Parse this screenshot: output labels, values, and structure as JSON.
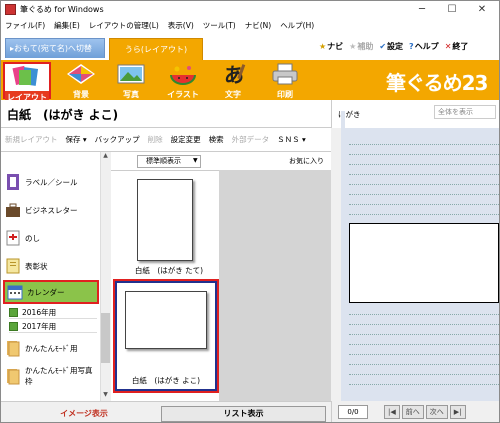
{
  "window": {
    "title": "筆ぐるめ for Windows",
    "min": "─",
    "max": "☐",
    "close": "✕"
  },
  "menu": [
    "ファイル(F)",
    "編集(E)",
    "レイアウトの管理(L)",
    "表示(V)",
    "ツール(T)",
    "ナビ(N)",
    "ヘルプ(H)"
  ],
  "tabs": {
    "front": "▸おもて(宛て名)へ切替",
    "back": "うら(レイアウト)"
  },
  "toplinks": [
    {
      "icon": "★",
      "label": "ナビ",
      "color": "#d4a000"
    },
    {
      "icon": "★",
      "label": "補助",
      "color": "#bbbbbb"
    },
    {
      "icon": "✔",
      "label": "設定",
      "color": "#2c6fc4"
    },
    {
      "icon": "?",
      "label": "ヘルプ",
      "color": "#2c6fc4"
    },
    {
      "icon": "✕",
      "label": "終了",
      "color": "#d02020"
    }
  ],
  "tools": [
    "レイアウト",
    "背景",
    "写真",
    "イラスト",
    "文字",
    "印刷"
  ],
  "brand": "筆ぐるめ23",
  "left_panel": {
    "title": "白紙　(はがき よこ)",
    "toolbar": [
      "新規レイアウト",
      "保存 ▾",
      "バックアップ",
      "削除",
      "設定変更",
      "検索",
      "外部データ",
      "ＳＮＳ ▾"
    ]
  },
  "right_panel": {
    "label": "はがき",
    "zoom": "全体を表示",
    "page": "0/0",
    "prev": "前へ",
    "next": "次へ",
    "first": "|◀",
    "last": "▶|"
  },
  "categories": [
    {
      "label": "ラベル／シール"
    },
    {
      "label": "ビジネスレター"
    },
    {
      "label": "のし"
    },
    {
      "label": "表彰状"
    },
    {
      "label": "カレンダー"
    },
    {
      "label": "かんたんﾓｰﾄﾞ用"
    },
    {
      "label": "かんたんﾓｰﾄﾞ用写真枠"
    }
  ],
  "subcategories": [
    "2016年用",
    "2017年用"
  ],
  "template_head": {
    "sort": "標準順表示",
    "favorites": "お気に入り"
  },
  "templates": [
    "白紙　(はがき たて)",
    "白紙　(はがき よこ)"
  ],
  "view_tabs": {
    "image": "イメージ表示",
    "list": "リスト表示"
  }
}
